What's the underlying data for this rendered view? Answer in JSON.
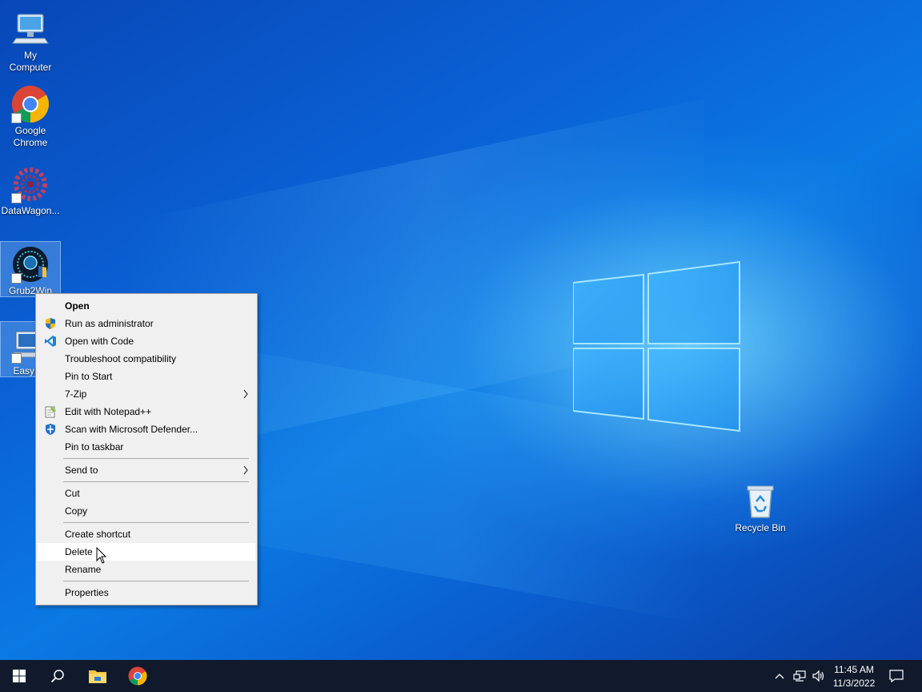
{
  "desktop": {
    "icons": [
      {
        "label": "My\nComputer"
      },
      {
        "label": "Google\nChrome"
      },
      {
        "label": "DataWagon..."
      },
      {
        "label": "Grub2Win"
      },
      {
        "label": "EasyBC"
      },
      {
        "label": "Recycle Bin"
      }
    ]
  },
  "context_menu": {
    "items": [
      {
        "label": "Open",
        "bold": true
      },
      {
        "label": "Run as administrator",
        "icon": "shield-icon"
      },
      {
        "label": "Open with Code",
        "icon": "vscode-icon"
      },
      {
        "label": "Troubleshoot compatibility"
      },
      {
        "label": "Pin to Start"
      },
      {
        "label": "7-Zip",
        "submenu": true
      },
      {
        "label": "Edit with Notepad++",
        "icon": "notepad-plus-plus-icon"
      },
      {
        "label": "Scan with Microsoft Defender...",
        "icon": "defender-icon"
      },
      {
        "label": "Pin to taskbar"
      },
      {
        "label": "Send to",
        "submenu": true
      },
      {
        "label": "Cut"
      },
      {
        "label": "Copy"
      },
      {
        "label": "Create shortcut"
      },
      {
        "label": "Delete",
        "hovered": true
      },
      {
        "label": "Rename"
      },
      {
        "label": "Properties"
      }
    ],
    "submenu_arrow": ">"
  },
  "taskbar": {
    "pinned": [
      "start-icon",
      "search-icon",
      "file-explorer-icon",
      "chrome-icon"
    ],
    "tray": [
      "chevron-up-icon",
      "network-icon",
      "volume-icon",
      "notifications-icon"
    ],
    "time": "11:45 AM",
    "date": "11/3/2022"
  },
  "colors": {
    "accent": "#0078d7",
    "taskbar": "#101a2c",
    "menu_bg": "#f0f0f0"
  }
}
